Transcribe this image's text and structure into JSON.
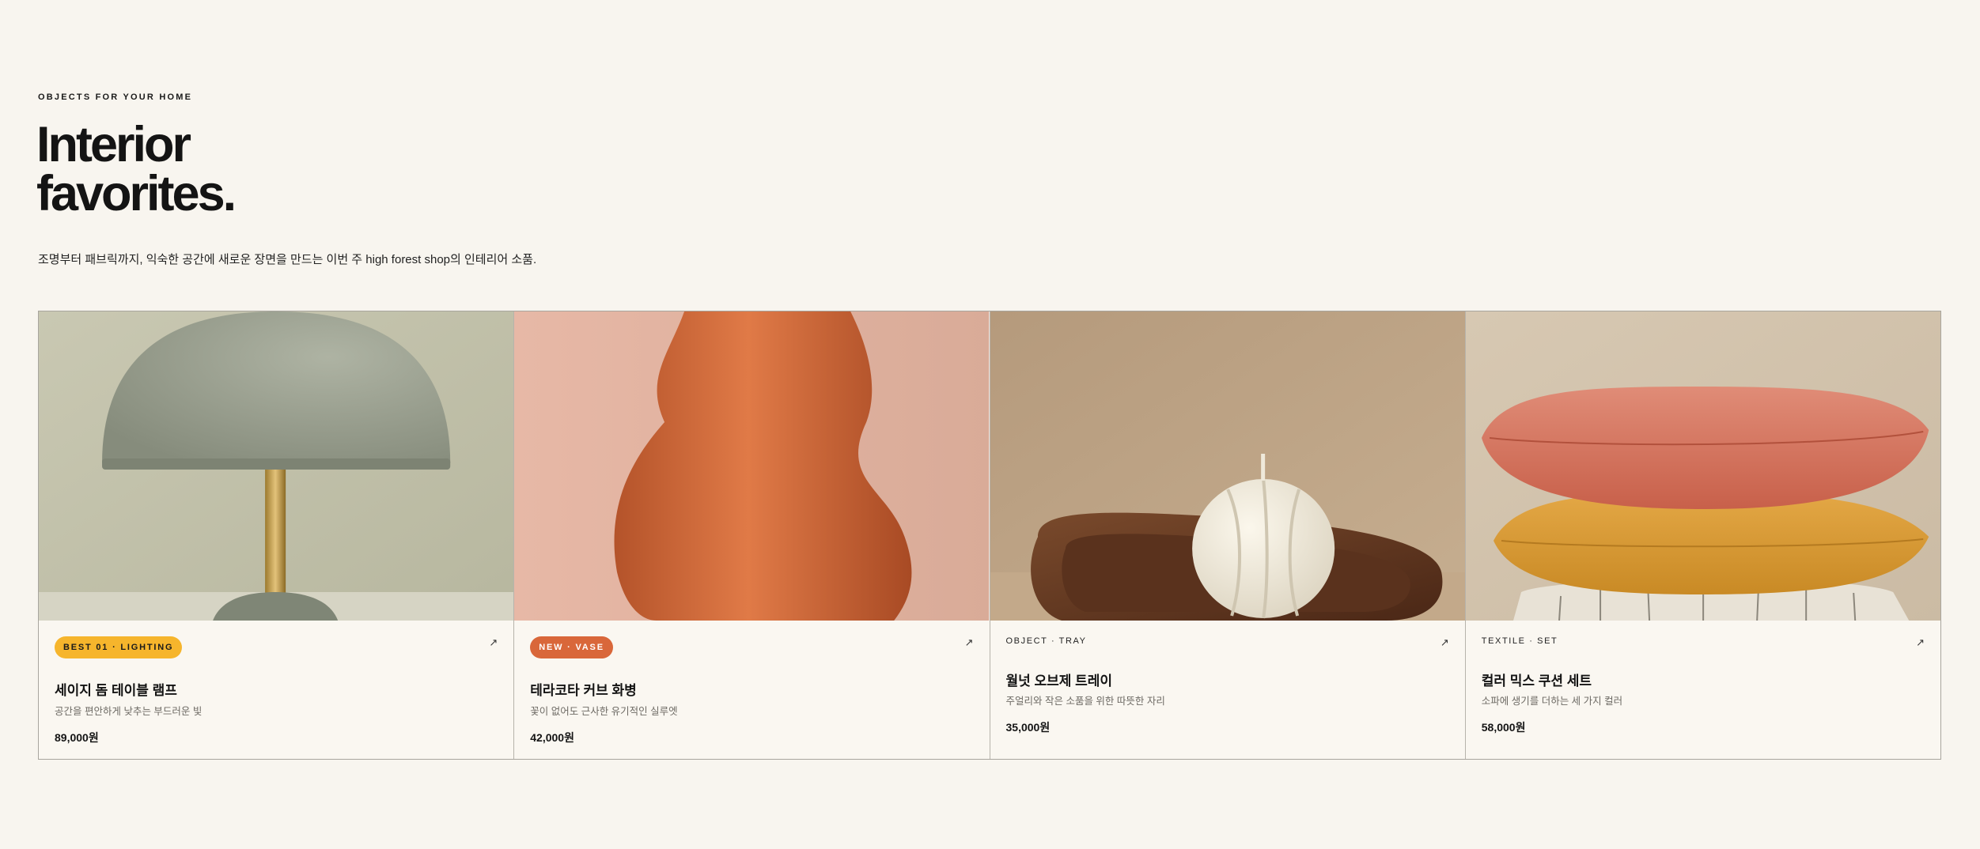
{
  "header": {
    "eyebrow": "OBJECTS FOR YOUR HOME",
    "title_line1": "Interior",
    "title_line2": "favorites.",
    "subtitle": "조명부터 패브릭까지, 익숙한 공간에 새로운 장면을 만드는 이번 주 high forest shop의 인테리어 소품."
  },
  "products": [
    {
      "badge": "BEST 01 · LIGHTING",
      "badge_color": "#f6b52c",
      "badge_text_color": "#1a1a1a",
      "arrow": "↗",
      "name": "세이지 돔 테이블 램프",
      "desc": "공간을 편안하게 낮추는 부드러운 빛",
      "price": "89,000원",
      "image_icon": "table-lamp"
    },
    {
      "badge": "NEW · VASE",
      "badge_color": "#d9673a",
      "badge_text_color": "#ffffff",
      "arrow": "↗",
      "name": "테라코타 커브 화병",
      "desc": "꽃이 없어도 근사한 유기적인 실루엣",
      "price": "42,000원",
      "image_icon": "terracotta-vase"
    },
    {
      "tag": "OBJECT · TRAY",
      "arrow": "↗",
      "name": "월넛 오브제 트레이",
      "desc": "주얼리와 작은 소품을 위한 따뜻한 자리",
      "price": "35,000원",
      "image_icon": "walnut-tray"
    },
    {
      "tag": "TEXTILE · SET",
      "arrow": "↗",
      "name": "컬러 믹스 쿠션 세트",
      "desc": "소파에 생기를 더하는 세 가지 컬러",
      "price": "58,000원",
      "image_icon": "cushion-stack"
    }
  ]
}
